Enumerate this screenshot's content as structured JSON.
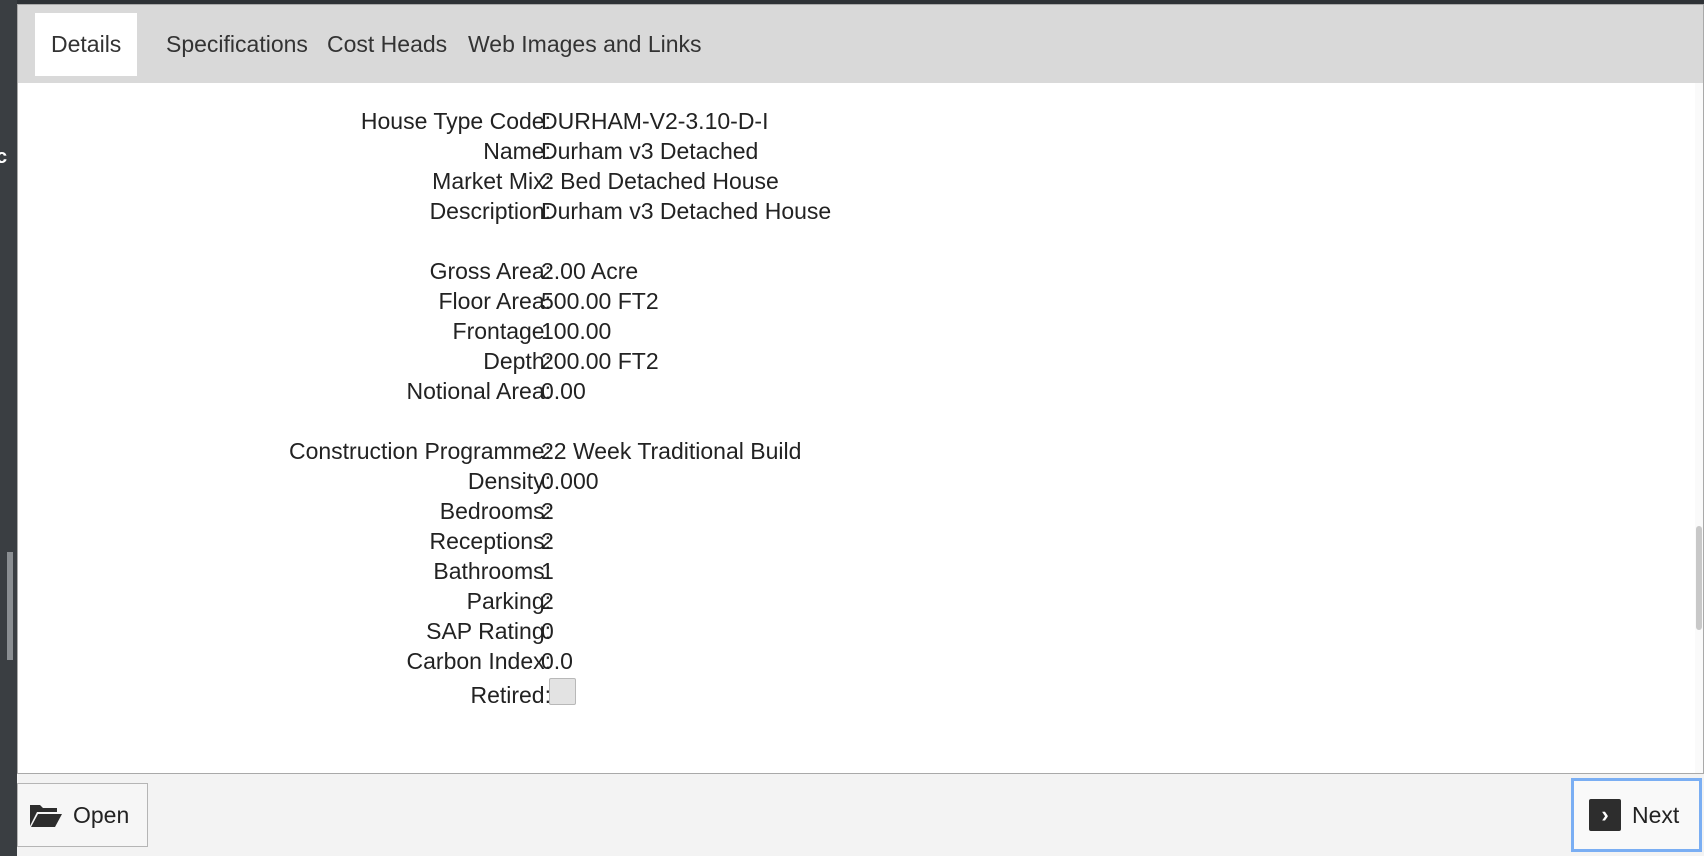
{
  "tabs": [
    {
      "label": "Details",
      "active": true
    },
    {
      "label": "Specifications",
      "active": false
    },
    {
      "label": "Cost Heads",
      "active": false
    },
    {
      "label": "Web Images and Links",
      "active": false
    }
  ],
  "details": {
    "house_type_code": {
      "label": "House Type Code:",
      "value": "DURHAM-V2-3.10-D-I"
    },
    "name": {
      "label": "Name:",
      "value": "Durham v3 Detached"
    },
    "market_mix": {
      "label": "Market Mix:",
      "value": "2 Bed Detached House"
    },
    "description": {
      "label": "Description:",
      "value": "Durham v3 Detached House"
    },
    "gross_area": {
      "label": "Gross Area:",
      "value": "2.00 Acre"
    },
    "floor_area": {
      "label": "Floor Area:",
      "value": "500.00 FT2"
    },
    "frontage": {
      "label": "Frontage:",
      "value": "100.00"
    },
    "depth": {
      "label": "Depth:",
      "value": "200.00 FT2"
    },
    "notional_area": {
      "label": "Notional Area:",
      "value": "0.00"
    },
    "construction_programme": {
      "label": "Construction Programme:",
      "value": "22 Week Traditional Build"
    },
    "density": {
      "label": "Density:",
      "value": "0.000"
    },
    "bedrooms": {
      "label": "Bedrooms:",
      "value": "2"
    },
    "receptions": {
      "label": "Receptions:",
      "value": "2"
    },
    "bathrooms": {
      "label": "Bathrooms:",
      "value": "1"
    },
    "parking": {
      "label": "Parking:",
      "value": "2"
    },
    "sap_rating": {
      "label": "SAP Rating:",
      "value": "0"
    },
    "carbon_index": {
      "label": "Carbon Index:",
      "value": "0.0"
    },
    "retired": {
      "label": "Retired:",
      "checked": false
    }
  },
  "footer": {
    "open_label": "Open",
    "next_label": "Next"
  },
  "icons": {
    "open": "folder-open-icon",
    "next": "chevron-right-icon"
  },
  "colors": {
    "tabbar": "#d9d9d9",
    "focus_ring": "#7aaef3"
  }
}
